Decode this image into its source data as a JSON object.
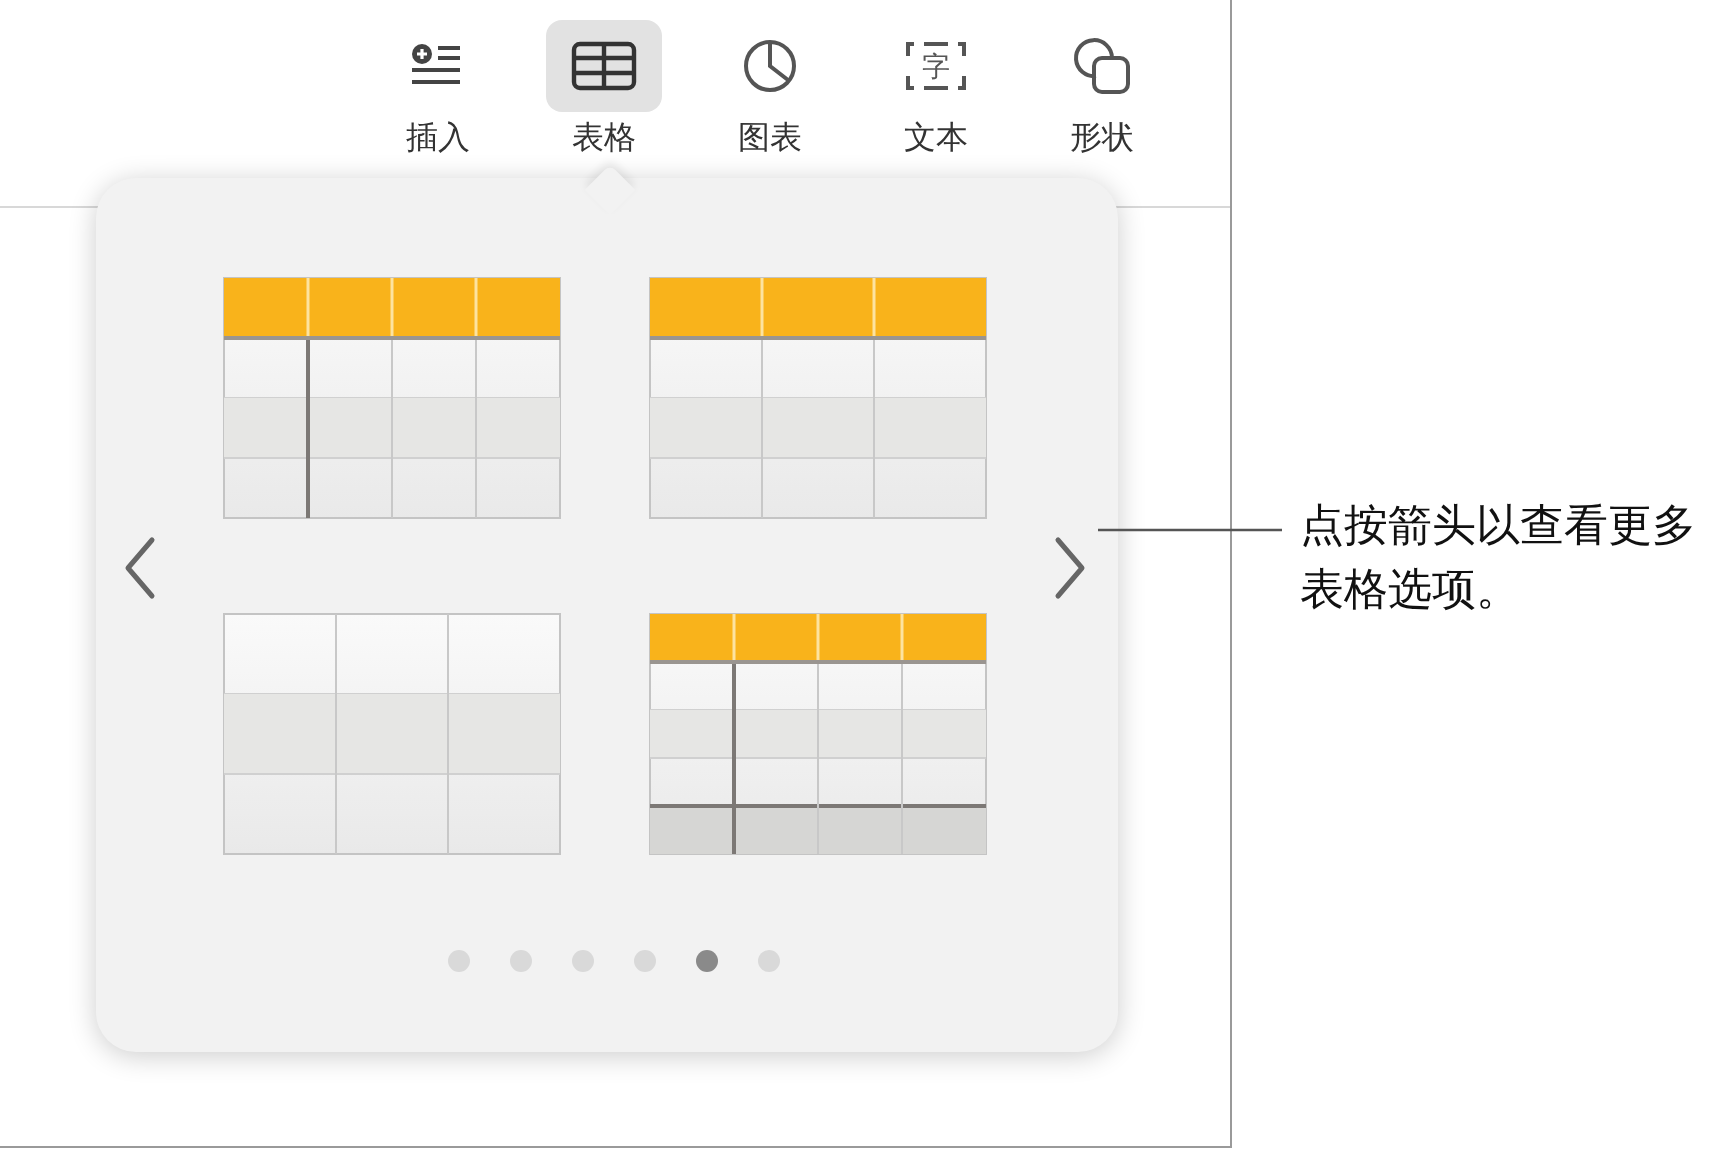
{
  "toolbar": {
    "items": [
      {
        "label": "插入",
        "selected": false
      },
      {
        "label": "表格",
        "selected": true
      },
      {
        "label": "图表",
        "selected": false
      },
      {
        "label": "文本",
        "icon_glyph": "字",
        "selected": false
      },
      {
        "label": "形状",
        "selected": false
      }
    ]
  },
  "popover": {
    "table_styles": [
      {
        "kind": "header-row-column"
      },
      {
        "kind": "header-row"
      },
      {
        "kind": "plain"
      },
      {
        "kind": "header-footer"
      }
    ],
    "pages": [
      {
        "selected": false
      },
      {
        "selected": false
      },
      {
        "selected": false
      },
      {
        "selected": false
      },
      {
        "selected": true
      },
      {
        "selected": false
      }
    ]
  },
  "callout": {
    "text": "点按箭头以查看更多表格选项。"
  }
}
